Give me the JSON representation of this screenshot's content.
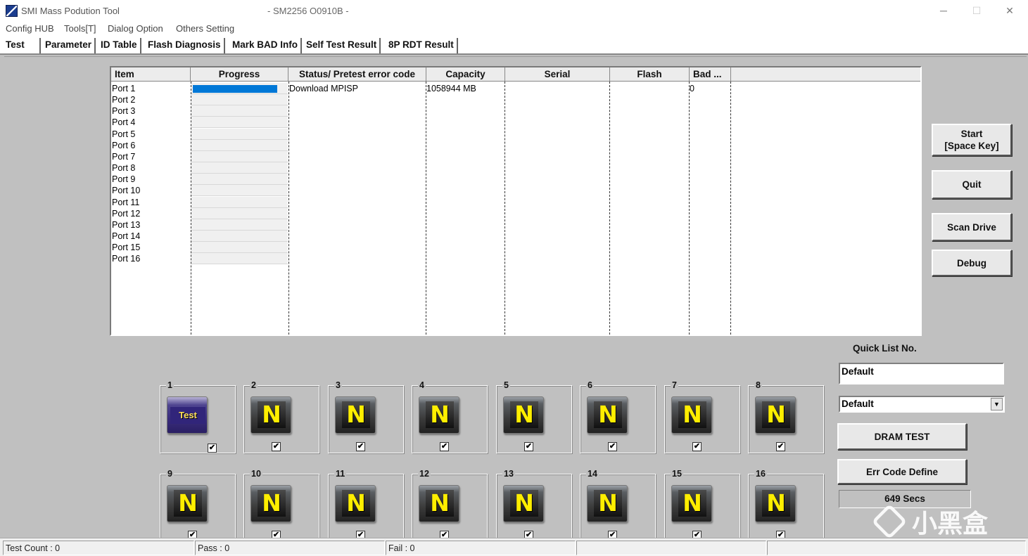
{
  "window": {
    "title": "SMI Mass Podution Tool",
    "subtitle": "- SM2256 O0910B -",
    "minimize": "─",
    "maximize": "☐",
    "close": "✕"
  },
  "menu": [
    "Config HUB",
    "Tools[T]",
    "Dialog Option",
    "Others Setting"
  ],
  "tabs": [
    "Test",
    "Parameter",
    "ID Table",
    "Flash Diagnosis",
    "Mark BAD Info",
    "Self Test Result",
    "8P RDT Result"
  ],
  "grid": {
    "columns": [
      "Item",
      "Progress",
      "Status/ Pretest error code",
      "Capacity",
      "Serial",
      "Flash",
      "Bad ..."
    ],
    "rows": [
      {
        "item": "Port 1",
        "progress": 0.9,
        "status": "Download MPISP",
        "capacity": "1058944 MB",
        "serial": "",
        "flash": "",
        "bad": "0"
      },
      {
        "item": "Port 2",
        "progress": 0
      },
      {
        "item": "Port 3",
        "progress": 0
      },
      {
        "item": "Port 4",
        "progress": 0
      },
      {
        "item": "Port 5",
        "progress": 0
      },
      {
        "item": "Port 6",
        "progress": 0
      },
      {
        "item": "Port 7",
        "progress": 0
      },
      {
        "item": "Port 8",
        "progress": 0
      },
      {
        "item": "Port 9",
        "progress": 0
      },
      {
        "item": "Port 10",
        "progress": 0
      },
      {
        "item": "Port 11",
        "progress": 0
      },
      {
        "item": "Port 12",
        "progress": 0
      },
      {
        "item": "Port 13",
        "progress": 0
      },
      {
        "item": "Port 14",
        "progress": 0
      },
      {
        "item": "Port 15",
        "progress": 0
      },
      {
        "item": "Port 16",
        "progress": 0
      }
    ]
  },
  "buttons": {
    "start": "Start\n[Space Key]",
    "quit": "Quit",
    "scan_drive": "Scan Drive",
    "debug": "Debug",
    "dram_test": "DRAM TEST",
    "err_code_define": "Err Code Define"
  },
  "quick_list": {
    "label": "Quick List No.",
    "input_value": "Default",
    "select_value": "Default",
    "arrow": "▼"
  },
  "timer": "649 Secs",
  "slots": [
    {
      "num": "1",
      "icon": "Test",
      "checked": true
    },
    {
      "num": "2",
      "icon": "N",
      "checked": true
    },
    {
      "num": "3",
      "icon": "N",
      "checked": true
    },
    {
      "num": "4",
      "icon": "N",
      "checked": true
    },
    {
      "num": "5",
      "icon": "N",
      "checked": true
    },
    {
      "num": "6",
      "icon": "N",
      "checked": true
    },
    {
      "num": "7",
      "icon": "N",
      "checked": true
    },
    {
      "num": "8",
      "icon": "N",
      "checked": true
    },
    {
      "num": "9",
      "icon": "N",
      "checked": true
    },
    {
      "num": "10",
      "icon": "N",
      "checked": true
    },
    {
      "num": "11",
      "icon": "N",
      "checked": true
    },
    {
      "num": "12",
      "icon": "N",
      "checked": true
    },
    {
      "num": "13",
      "icon": "N",
      "checked": true
    },
    {
      "num": "14",
      "icon": "N",
      "checked": true
    },
    {
      "num": "15",
      "icon": "N",
      "checked": true
    },
    {
      "num": "16",
      "icon": "N",
      "checked": true
    }
  ],
  "checkmark": "✔",
  "status": {
    "test_count": "Test Count : 0",
    "pass": "Pass : 0",
    "fail": "Fail : 0"
  },
  "watermark": "小黑盒",
  "colors": {
    "progress_fill": "#0078d7",
    "n_icon_letter": "#ffee00",
    "test_icon_bg": "#3a2d7d"
  }
}
